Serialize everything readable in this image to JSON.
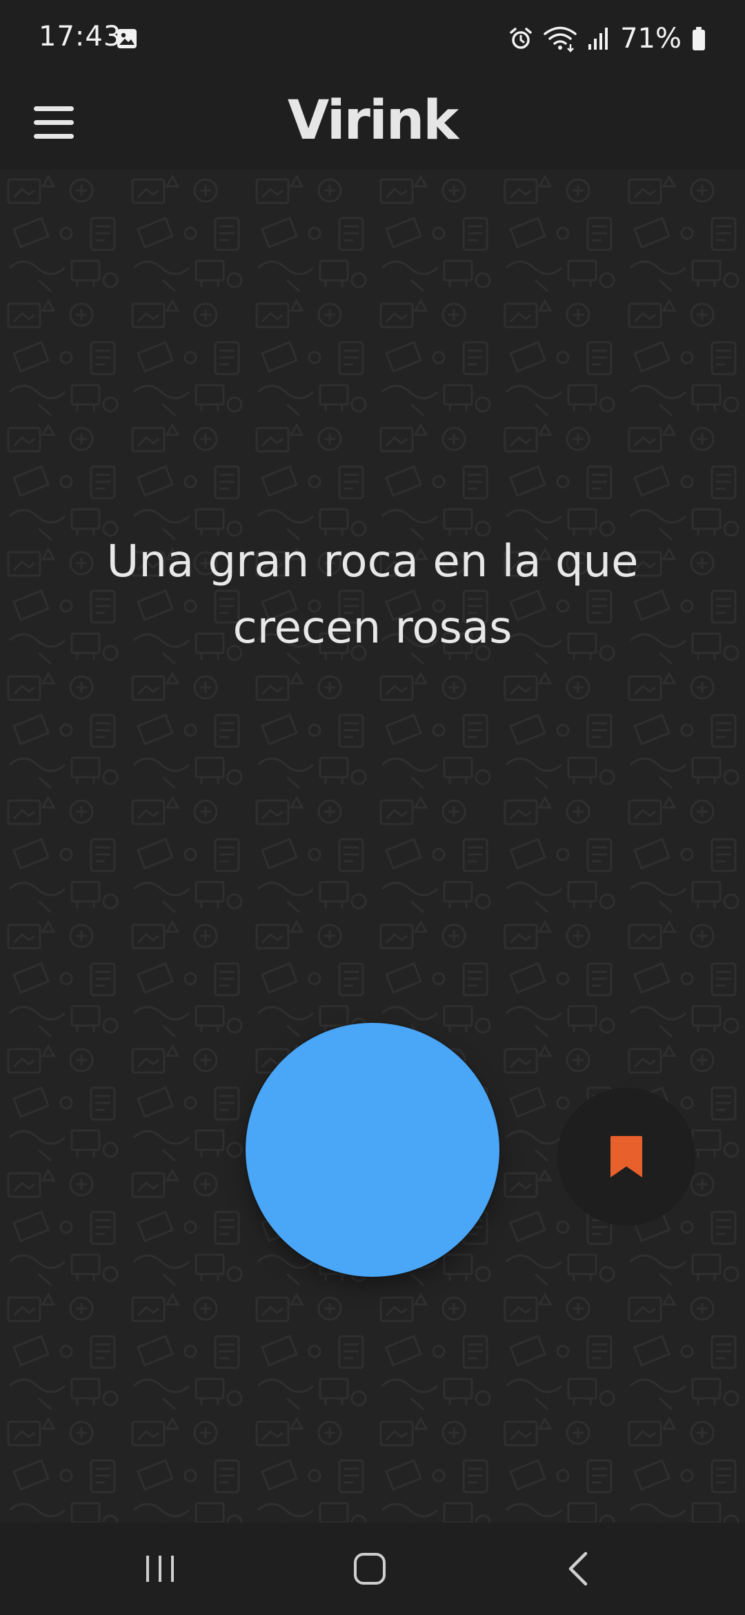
{
  "status_bar": {
    "time": "17:43",
    "battery": "71%",
    "icons": [
      "gallery-icon",
      "alarm-icon",
      "wifi-icon",
      "signal-icon",
      "battery-icon"
    ]
  },
  "app_bar": {
    "title": "Virink",
    "menu_icon": "hamburger-menu-icon"
  },
  "main": {
    "prompt": "Una gran roca en la que crecen rosas",
    "record_button_color": "#4aa6f7",
    "bookmark_icon": "bookmark-icon",
    "bookmark_color": "#e8602c"
  },
  "nav_bar": {
    "items": [
      "recent-apps-icon",
      "home-icon",
      "back-icon"
    ]
  }
}
